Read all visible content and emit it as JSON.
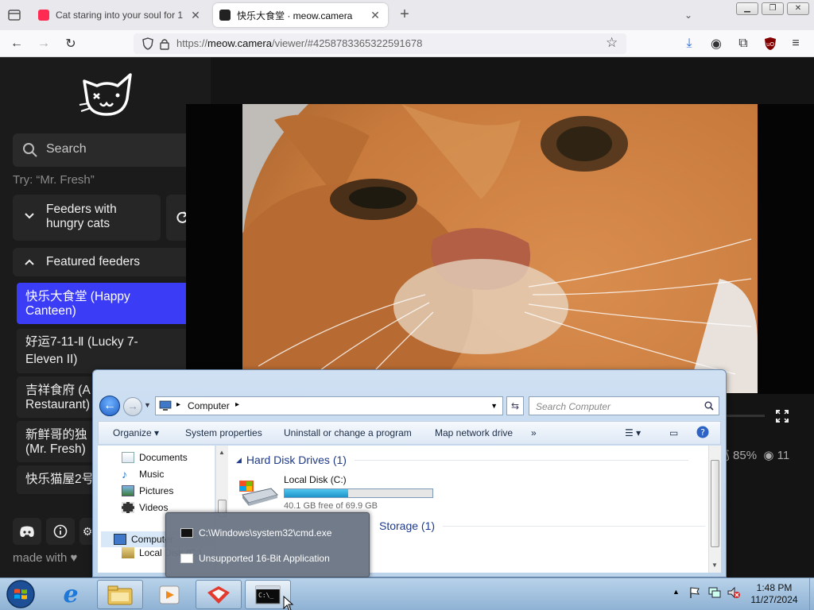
{
  "browser": {
    "tabs": [
      {
        "title": "Cat staring into your soul for 1",
        "active": false,
        "favicon_color": "#ff2b53"
      },
      {
        "title": "快乐大食堂 · meow.camera",
        "active": true,
        "favicon_color": "#222222"
      }
    ],
    "url": {
      "scheme": "https://",
      "host": "meow.camera",
      "path": "/viewer/#4258783365322591678"
    }
  },
  "sidebar": {
    "search_placeholder": "Search",
    "try_hint": "Try: “Mr. Fresh”",
    "hungry_section": {
      "label_line1": "Feeders with",
      "label_line2": "hungry cats"
    },
    "featured_section": {
      "label": "Featured feeders"
    },
    "feeders": [
      {
        "line1": "快乐大食堂 (Happy",
        "line2": "Canteen)",
        "selected": true
      },
      {
        "line1": "好运7-11-Ⅱ (Lucky 7-",
        "line2": "Eleven II)",
        "selected": false
      },
      {
        "line1": "吉祥食府 (A",
        "line2": "Restaurant)",
        "selected": false
      },
      {
        "line1": "新鲜哥的独",
        "line2": "(Mr. Fresh)",
        "selected": false
      },
      {
        "line1": "快乐猫屋2号",
        "line2": "",
        "selected": false
      }
    ],
    "made_with": "made with ♥"
  },
  "player": {
    "percent": "85%",
    "viewers": "11"
  },
  "explorer": {
    "breadcrumb": "Computer",
    "search_placeholder": "Search Computer",
    "toolbar": [
      "Organize",
      "System properties",
      "Uninstall or change a program",
      "Map network drive"
    ],
    "toolbar_more": "»",
    "nav_items": [
      "Documents",
      "Music",
      "Pictures",
      "Videos"
    ],
    "nav_computer": "Computer",
    "nav_local": "Local Disk (C:)",
    "groups": {
      "hdd": "Hard Disk Drives (1)",
      "removable": "Storage (1)"
    },
    "disk": {
      "name": "Local Disk (C:)",
      "free_text": "40.1 GB free of 69.9 GB",
      "used_fraction": 0.43
    }
  },
  "jumplist": {
    "items": [
      "C:\\Windows\\system32\\cmd.exe",
      "Unsupported 16-Bit Application"
    ]
  },
  "taskbar": {
    "time": "1:48 PM",
    "date": "11/27/2024"
  }
}
